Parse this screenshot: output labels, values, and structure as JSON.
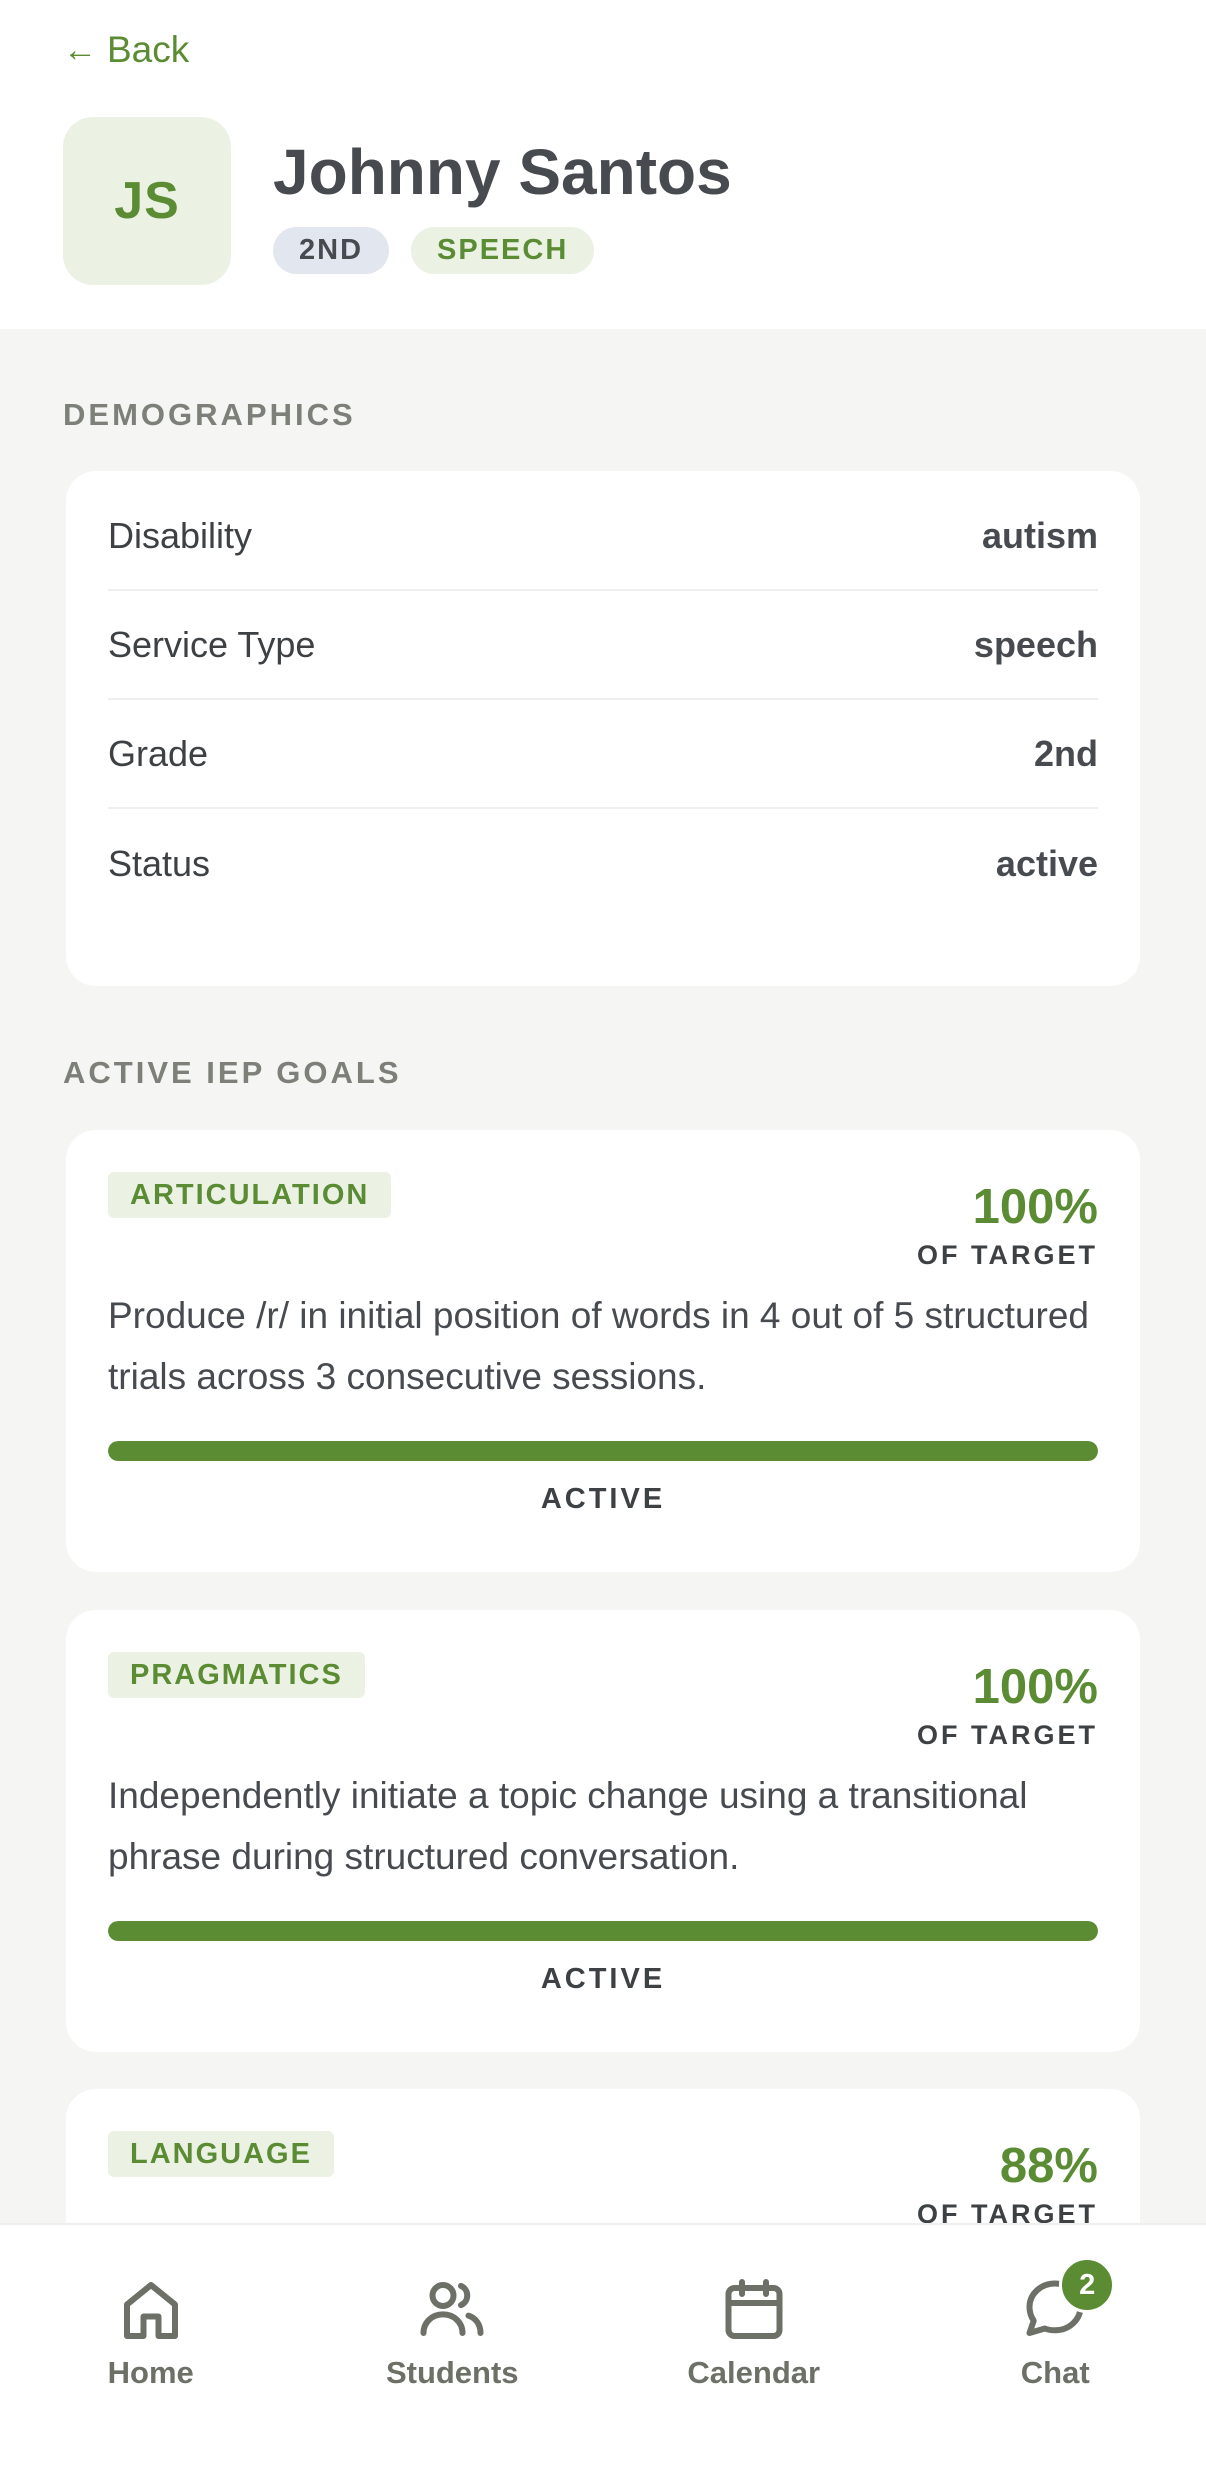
{
  "back": {
    "label": "Back"
  },
  "student": {
    "initials": "JS",
    "name": "Johnny Santos",
    "tags": {
      "grade": "2ND",
      "service": "SPEECH"
    }
  },
  "demographics": {
    "title": "DEMOGRAPHICS",
    "rows": [
      {
        "label": "Disability",
        "value": "autism"
      },
      {
        "label": "Service Type",
        "value": "speech"
      },
      {
        "label": "Grade",
        "value": "2nd"
      },
      {
        "label": "Status",
        "value": "active"
      }
    ]
  },
  "goals": {
    "title": "ACTIVE IEP GOALS",
    "items": [
      {
        "category": "ARTICULATION",
        "percent": "100%",
        "percent_value": 100,
        "percent_caption": "OF TARGET",
        "description": "Produce /r/ in initial position of words in 4 out of 5 structured trials across 3 consecutive sessions.",
        "status": "ACTIVE"
      },
      {
        "category": "PRAGMATICS",
        "percent": "100%",
        "percent_value": 100,
        "percent_caption": "OF TARGET",
        "description": "Independently initiate a topic change using a transitional phrase during structured conversation.",
        "status": "ACTIVE"
      },
      {
        "category": "LANGUAGE",
        "percent": "88%",
        "percent_value": 88,
        "percent_caption": "OF TARGET"
      }
    ]
  },
  "nav": {
    "items": [
      {
        "label": "Home",
        "icon": "home-icon"
      },
      {
        "label": "Students",
        "icon": "students-icon"
      },
      {
        "label": "Calendar",
        "icon": "calendar-icon"
      },
      {
        "label": "Chat",
        "icon": "chat-icon",
        "badge": "2"
      }
    ]
  },
  "colors": {
    "accent": "#5b8c34",
    "accent_light": "#ebf2e4",
    "background": "#f5f5f3"
  }
}
